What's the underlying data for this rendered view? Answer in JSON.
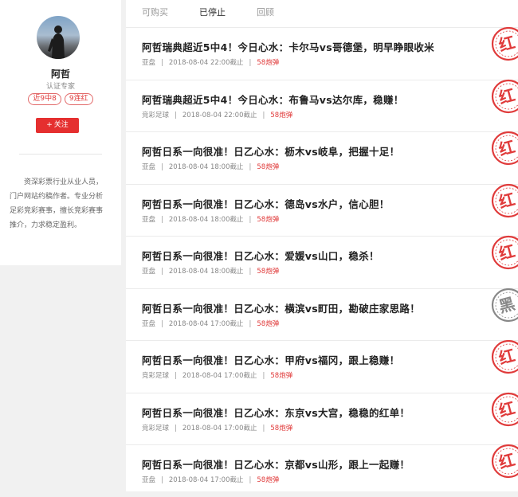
{
  "profile": {
    "name": "阿哲",
    "cert": "认证专家",
    "badges": [
      "近9中8",
      "9连红"
    ],
    "follow_label": "关注",
    "follow_icon": "plus-icon",
    "bio": "资深彩票行业从业人员，门户网站约稿作者。专业分析足彩竞彩赛事，擅长竞彩赛事推介，力求稳定盈利。"
  },
  "tabs": [
    "可购买",
    "已停止",
    "回顾"
  ],
  "active_tab": "已停止",
  "colors": {
    "accent": "#e52f2f",
    "stamp_red": "#e03b3b",
    "stamp_black": "#888888"
  },
  "items": [
    {
      "title": "阿哲瑞典超近5中4！今日心水：卡尔马vs哥德堡，明早睁眼收米",
      "category": "亚盘",
      "deadline": "2018-08-04 22:00截止",
      "count": "58炮弹",
      "result": "红"
    },
    {
      "title": "阿哲瑞典超近5中4！今日心水：布鲁马vs达尔库，稳赚！",
      "category": "竞彩足球",
      "deadline": "2018-08-04 22:00截止",
      "count": "58炮弹",
      "result": "红"
    },
    {
      "title": "阿哲日系一向很准！日乙心水：枥木vs岐阜，把握十足！",
      "category": "亚盘",
      "deadline": "2018-08-04 18:00截止",
      "count": "58炮弹",
      "result": "红"
    },
    {
      "title": "阿哲日系一向很准！日乙心水：德岛vs水户，信心胆！",
      "category": "亚盘",
      "deadline": "2018-08-04 18:00截止",
      "count": "58炮弹",
      "result": "红"
    },
    {
      "title": "阿哲日系一向很准！日乙心水：爱媛vs山口，稳杀！",
      "category": "亚盘",
      "deadline": "2018-08-04 18:00截止",
      "count": "58炮弹",
      "result": "红"
    },
    {
      "title": "阿哲日系一向很准！日乙心水：横滨vs町田，勘破庄家思路！",
      "category": "亚盘",
      "deadline": "2018-08-04 17:00截止",
      "count": "58炮弹",
      "result": "黑"
    },
    {
      "title": "阿哲日系一向很准！日乙心水：甲府vs福冈，跟上稳赚！",
      "category": "竞彩足球",
      "deadline": "2018-08-04 17:00截止",
      "count": "58炮弹",
      "result": "红"
    },
    {
      "title": "阿哲日系一向很准！日乙心水：东京vs大宫，稳稳的红单！",
      "category": "竞彩足球",
      "deadline": "2018-08-04 17:00截止",
      "count": "58炮弹",
      "result": "红"
    },
    {
      "title": "阿哲日系一向很准！日乙心水：京都vs山形，跟上一起赚！",
      "category": "亚盘",
      "deadline": "2018-08-04 17:00截止",
      "count": "58炮弹",
      "result": "红"
    }
  ]
}
